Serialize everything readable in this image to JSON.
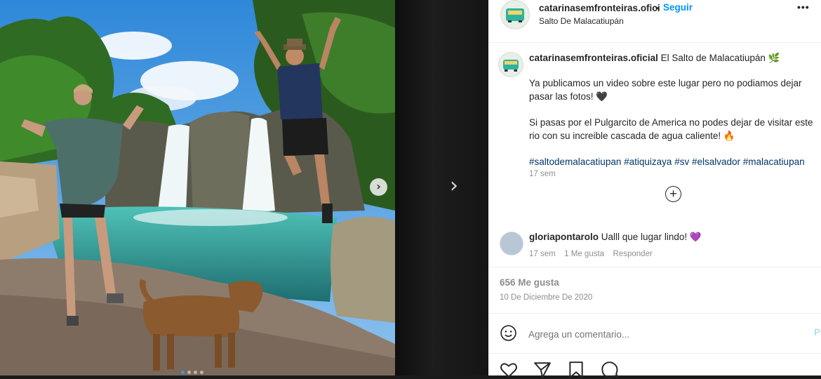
{
  "post": {
    "author": "catarinasemfronteiras.ofici",
    "follow_label": "Seguir",
    "location": "Salto De Malacatiupán",
    "caption_author": "catarinasemfronteiras.oficial",
    "caption_title": "El Salto de Malacatiupán",
    "caption_line1": "Ya publicamos un video sobre este lugar pero no podiamos dejar",
    "caption_line2": "pasar las fotos! 🖤",
    "caption_line3": "Si pasas por el Pulgarcito de America no podes dejar de visitar este",
    "caption_line4": "rio con su increible cascada de agua caliente! 🔥",
    "hashtags": [
      "#saltodemalacatiupan",
      "#atiquizaya",
      "#sv",
      "#elsalvador",
      "#malacatiupan"
    ],
    "caption_time": "17 sem",
    "carousel_dots": 4,
    "carousel_active": 0
  },
  "comment": {
    "user": "gloriapontarolo",
    "text": "Ualll que lugar lindo!",
    "emoji": "💜",
    "time": "17 sem",
    "likes": "1 Me gusta",
    "reply": "Responder"
  },
  "stats": {
    "likes": "656 Me gusta",
    "date": "10 De Diciembre De 2020"
  },
  "composer": {
    "placeholder": "Agrega un comentario...",
    "post_label": "Pu"
  },
  "colors": {
    "accent": "#0095f6",
    "hashtag": "#00376b",
    "muted": "#8e8e8e"
  }
}
